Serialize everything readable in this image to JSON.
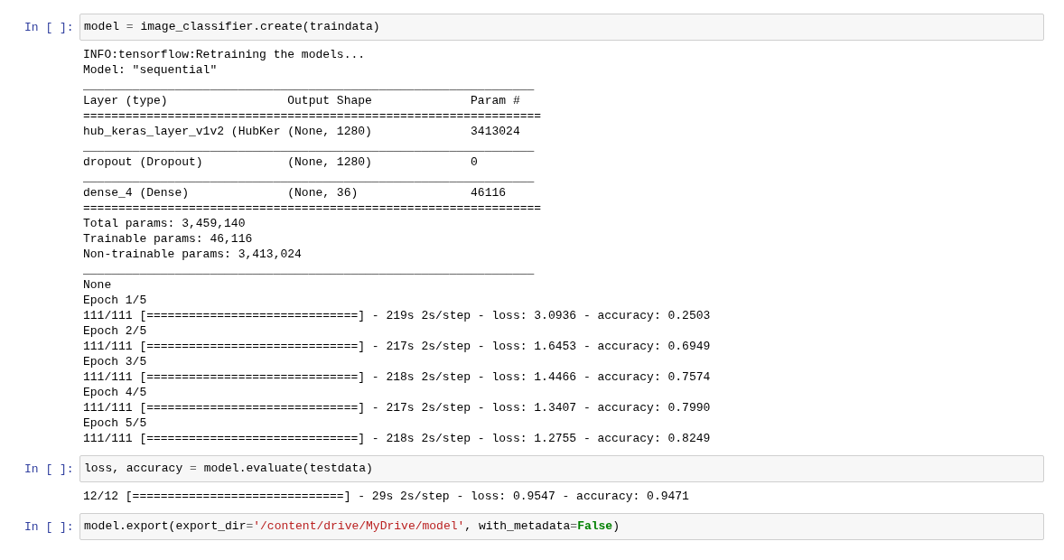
{
  "cells": [
    {
      "prompt": "In [ ]:",
      "code": [
        {
          "kind": "name",
          "text": "model "
        },
        {
          "kind": "operator",
          "text": "="
        },
        {
          "kind": "name",
          "text": " image_classifier.create(traindata)"
        }
      ],
      "output": [
        "INFO:tensorflow:Retraining the models...",
        "Model: \"sequential\"",
        "________________________________________________________________",
        "Layer (type)                 Output Shape              Param #   ",
        "=================================================================",
        "hub_keras_layer_v1v2 (HubKer (None, 1280)              3413024   ",
        "________________________________________________________________",
        "dropout (Dropout)            (None, 1280)              0         ",
        "________________________________________________________________",
        "dense_4 (Dense)              (None, 36)                46116     ",
        "=================================================================",
        "Total params: 3,459,140",
        "Trainable params: 46,116",
        "Non-trainable params: 3,413,024",
        "________________________________________________________________",
        "None",
        "Epoch 1/5",
        "111/111 [==============================] - 219s 2s/step - loss: 3.0936 - accuracy: 0.2503",
        "Epoch 2/5",
        "111/111 [==============================] - 217s 2s/step - loss: 1.6453 - accuracy: 0.6949",
        "Epoch 3/5",
        "111/111 [==============================] - 218s 2s/step - loss: 1.4466 - accuracy: 0.7574",
        "Epoch 4/5",
        "111/111 [==============================] - 217s 2s/step - loss: 1.3407 - accuracy: 0.7990",
        "Epoch 5/5",
        "111/111 [==============================] - 218s 2s/step - loss: 1.2755 - accuracy: 0.8249"
      ]
    },
    {
      "prompt": "In [ ]:",
      "code": [
        {
          "kind": "name",
          "text": "loss, accuracy "
        },
        {
          "kind": "operator",
          "text": "="
        },
        {
          "kind": "name",
          "text": " model.evaluate(testdata)"
        }
      ],
      "output": [
        "12/12 [==============================] - 29s 2s/step - loss: 0.9547 - accuracy: 0.9471"
      ]
    },
    {
      "prompt": "In [ ]:",
      "code": [
        {
          "kind": "name",
          "text": "model.export(export_dir"
        },
        {
          "kind": "operator",
          "text": "="
        },
        {
          "kind": "string",
          "text": "'/content/drive/MyDrive/model'"
        },
        {
          "kind": "name",
          "text": ", with_metadata"
        },
        {
          "kind": "operator",
          "text": "="
        },
        {
          "kind": "keyword",
          "text": "False"
        },
        {
          "kind": "name",
          "text": ")"
        }
      ]
    }
  ]
}
